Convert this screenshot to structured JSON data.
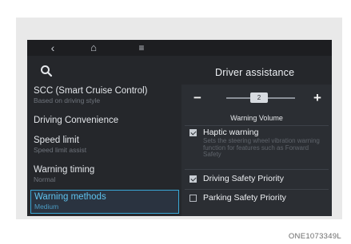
{
  "nav": {
    "back": "‹",
    "home": "⌂",
    "menu": "≡"
  },
  "panel_title": "Driver assistance",
  "menu": [
    {
      "label": "SCC (Smart Cruise Control)",
      "sub": "Based on driving style"
    },
    {
      "label": "Driving Convenience",
      "sub": ""
    },
    {
      "label": "Speed limit",
      "sub": "Speed limit assist"
    },
    {
      "label": "Warning timing",
      "sub": "Normal"
    },
    {
      "label": "Warning methods",
      "sub": "Medium"
    }
  ],
  "volume": {
    "minus": "−",
    "plus": "+",
    "value": "2",
    "label": "Warning Volume"
  },
  "options": [
    {
      "label": "Haptic warning",
      "desc": "Sets the steering wheel vibration warning function for features such as Forward Safety",
      "checked": true
    },
    {
      "label": "Driving Safety Priority",
      "checked": true
    },
    {
      "label": "Parking Safety Priority",
      "checked": false
    }
  ],
  "caption": "ONE1073349L"
}
